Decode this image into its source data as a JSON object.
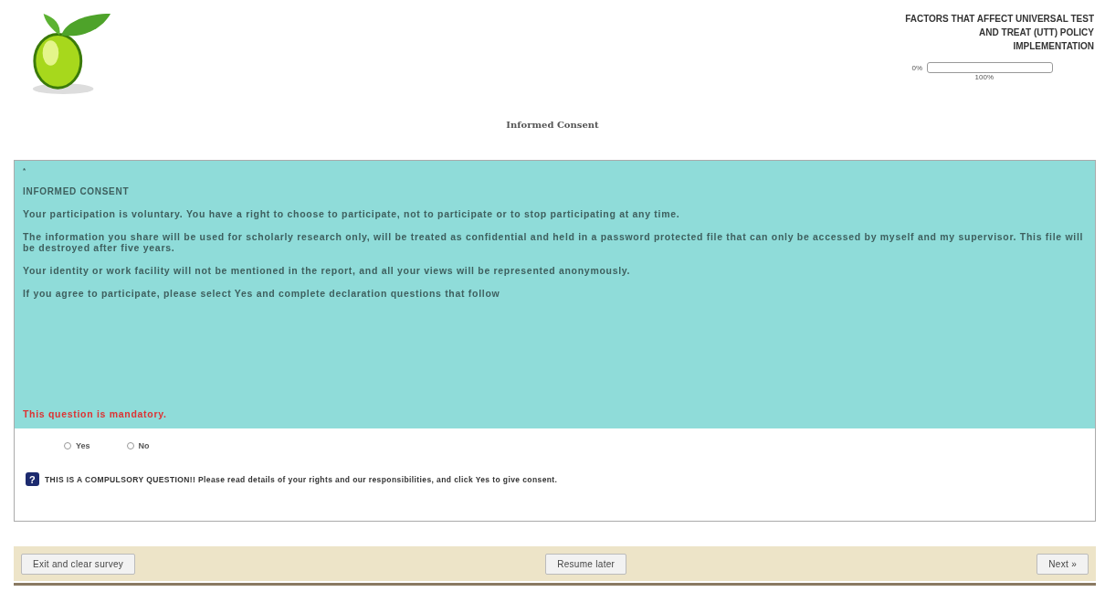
{
  "survey_title": "FACTORS THAT AFFECT UNIVERSAL TEST AND TREAT (UTT) POLICY IMPLEMENTATION",
  "progress": {
    "start_label": "0%",
    "end_label": "100%",
    "level": 0
  },
  "group_title": "Informed Consent",
  "question": {
    "mandatory_mark": "*",
    "heading": "INFORMED CONSENT",
    "paragraphs": [
      "Your participation is voluntary. You have a right to choose to participate, not to participate or to stop participating at any time.",
      "The information you share will  be used for scholarly research only, will be treated as confidential and held in a password protected file that can only be accessed by myself and my supervisor. This file will be destroyed after five years.",
      "Your identity or work facility will not be mentioned in the report, and all your views will be represented anonymously.",
      "If you agree to participate, please select Yes and complete declaration questions that follow"
    ],
    "mandatory_note": "This question is mandatory.",
    "options": [
      {
        "label": "Yes",
        "selected": false
      },
      {
        "label": "No",
        "selected": false
      }
    ],
    "help_icon": "?",
    "help_text": "THIS IS A COMPULSORY QUESTION!! Please read details of your rights and our responsibilities, and click Yes to give consent."
  },
  "buttons": [
    {
      "label": "Exit and clear survey"
    },
    {
      "label": "Resume later"
    },
    {
      "label": "Next »"
    }
  ]
}
